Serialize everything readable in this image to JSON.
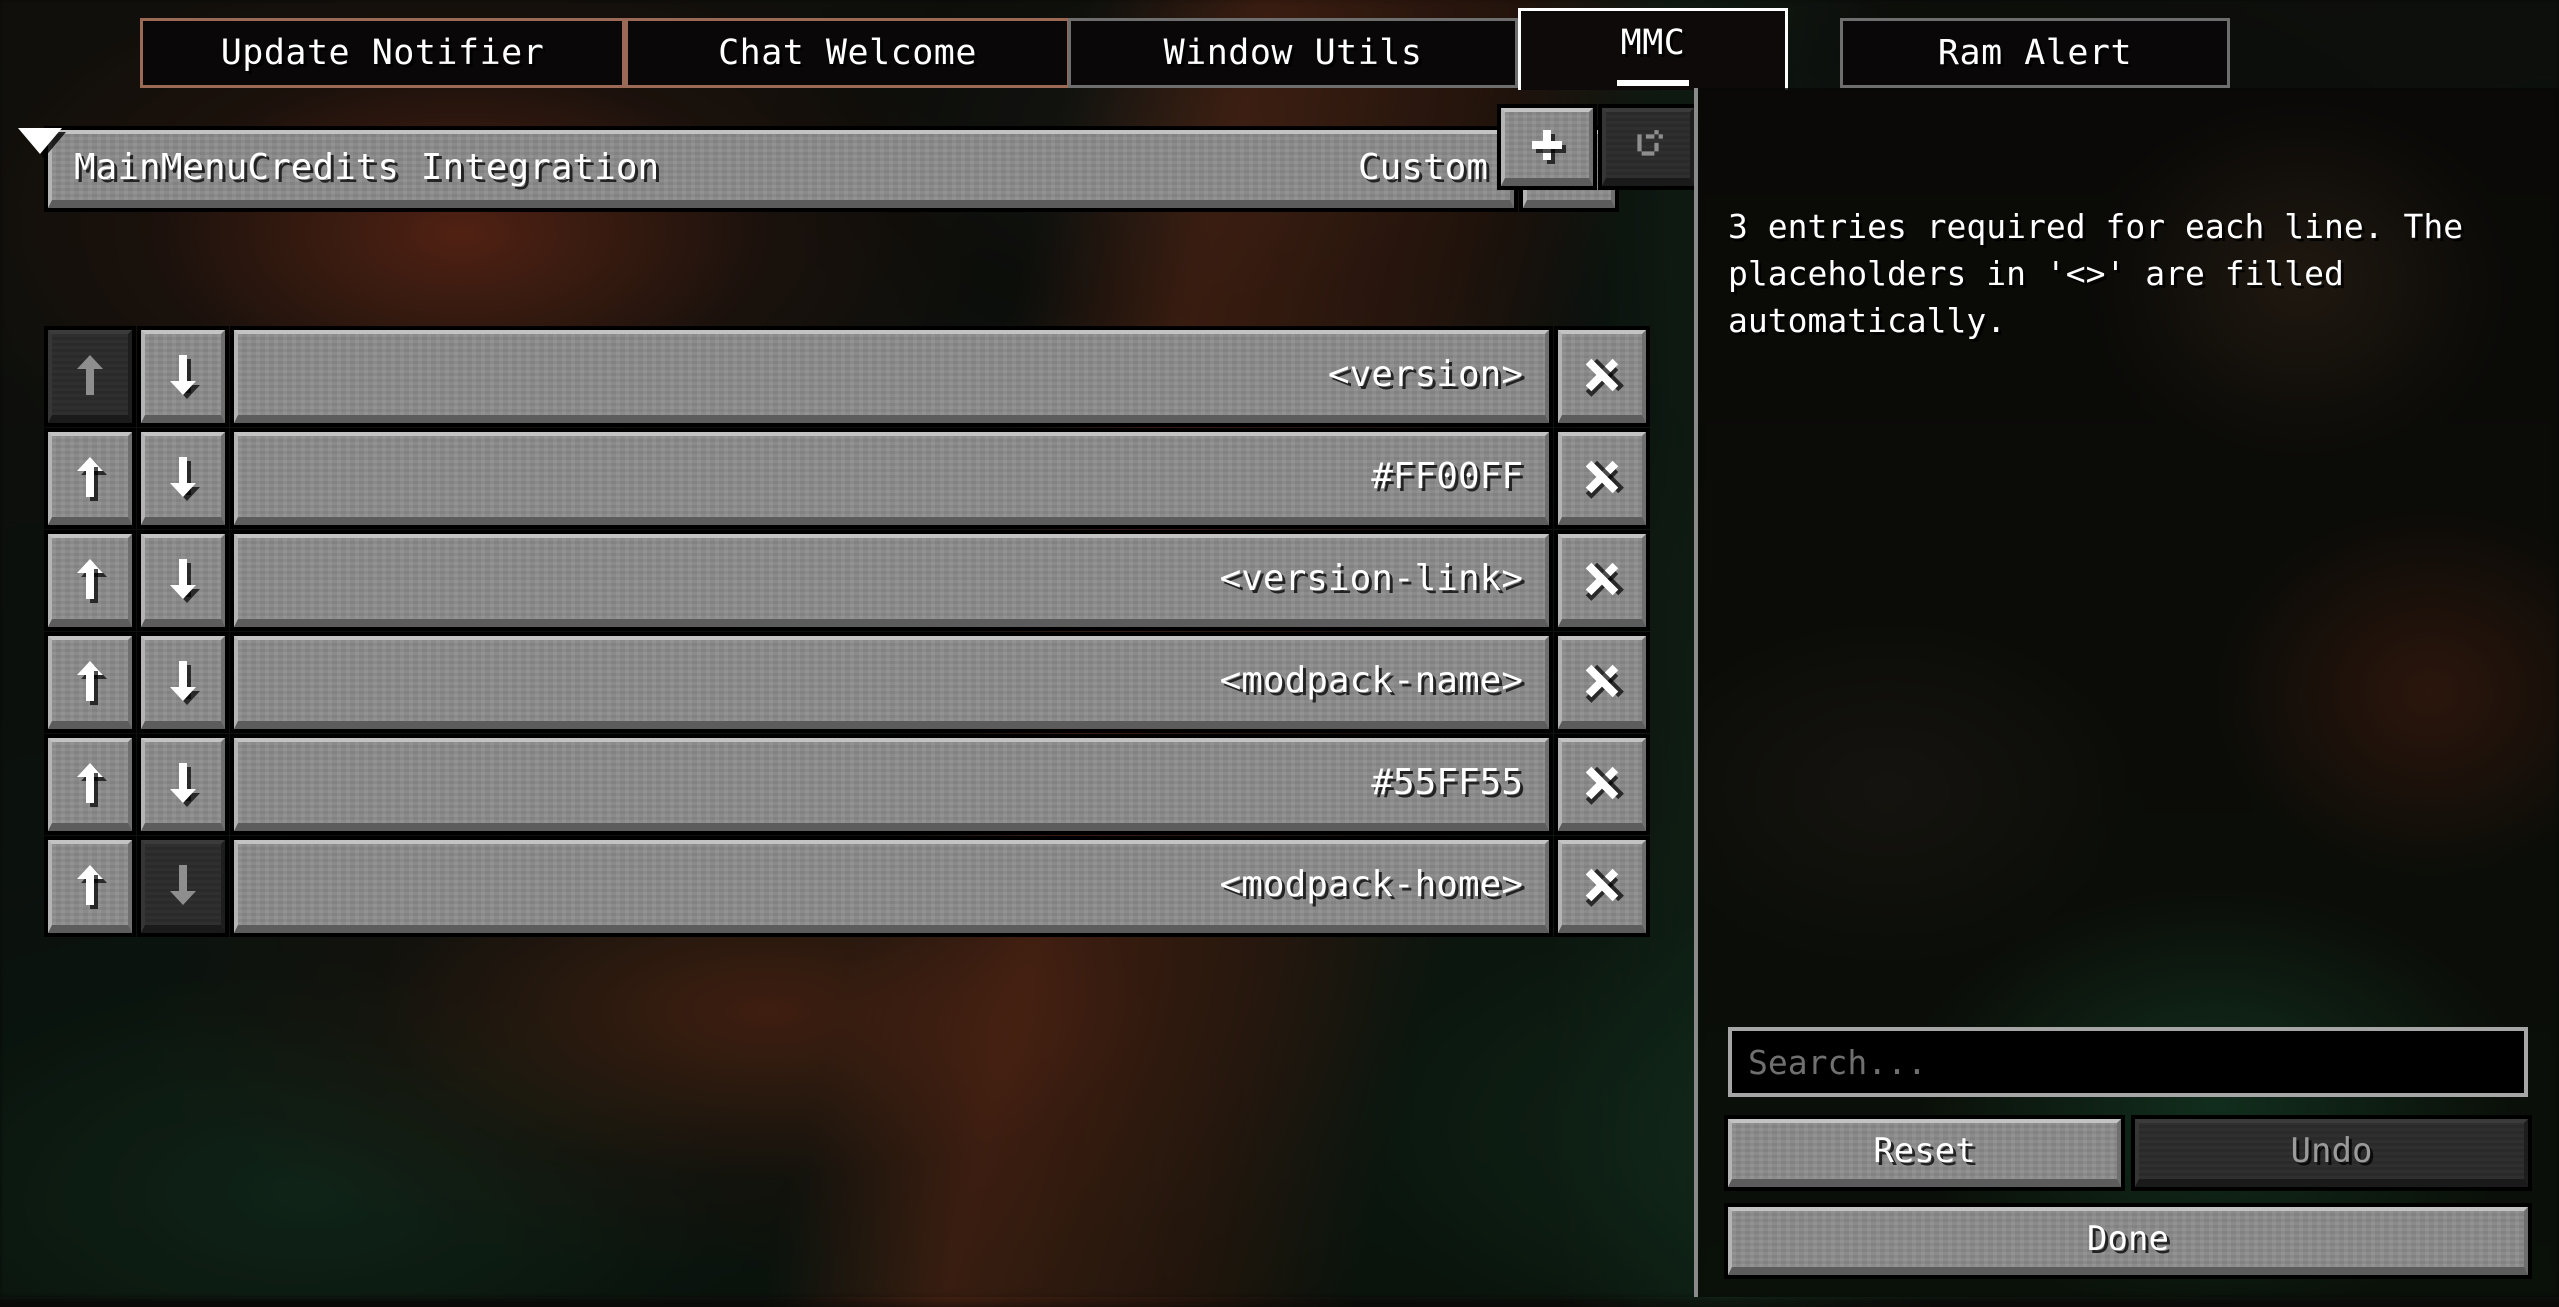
{
  "tabs": [
    {
      "label": "Update Notifier",
      "active": false,
      "accent": "warm"
    },
    {
      "label": "Chat Welcome",
      "active": false,
      "accent": "warm"
    },
    {
      "label": "Window Utils",
      "active": false,
      "accent": "cool"
    },
    {
      "label": "MMC",
      "active": true,
      "accent": "cool"
    },
    {
      "label": "Ram Alert",
      "active": false,
      "accent": "cool"
    }
  ],
  "config": {
    "header": {
      "name": "MainMenuCredits Integration",
      "value": "Custom",
      "reset_icon": "reset-circular-arrow-icon",
      "reset_enabled": true
    },
    "toolbar": {
      "collapse_icon": "caret-down-icon",
      "add_icon": "plus-icon",
      "add_label": "+",
      "reset_icon": "reset-circular-arrow-icon",
      "reset_enabled": false
    },
    "entries": [
      {
        "value": "<version>",
        "up_enabled": false,
        "down_enabled": true,
        "delete_enabled": true
      },
      {
        "value": "#FF00FF",
        "up_enabled": true,
        "down_enabled": true,
        "delete_enabled": true
      },
      {
        "value": "<version-link>",
        "up_enabled": true,
        "down_enabled": true,
        "delete_enabled": true
      },
      {
        "value": "<modpack-name>",
        "up_enabled": true,
        "down_enabled": true,
        "delete_enabled": true
      },
      {
        "value": "#55FF55",
        "up_enabled": true,
        "down_enabled": true,
        "delete_enabled": true
      },
      {
        "value": "<modpack-home>",
        "up_enabled": true,
        "down_enabled": false,
        "delete_enabled": true
      }
    ]
  },
  "side_panel": {
    "description": "3 entries required for each line. The placeholders in '<>' are filled automatically.",
    "search": {
      "placeholder": "Search...",
      "value": ""
    },
    "buttons": {
      "reset": {
        "label": "Reset",
        "enabled": true
      },
      "undo": {
        "label": "Undo",
        "enabled": false
      },
      "done": {
        "label": "Done",
        "enabled": true
      }
    }
  },
  "colors": {
    "widget_face": "#8b8b8b",
    "widget_highlight": "#c3c3c3",
    "widget_shadow": "#5c5c5c",
    "disabled_face": "#2b2b2b",
    "disabled_text": "#9a9a9a",
    "text": "#ffffff",
    "tab_border_active": "#ffffff",
    "tab_border_inactive": "#6e6e6e",
    "tab_border_warm": "#9a6a57",
    "search_border": "#a6a6a6",
    "placeholder_text": "#707070",
    "panel_divider": "#8a8a8a"
  }
}
